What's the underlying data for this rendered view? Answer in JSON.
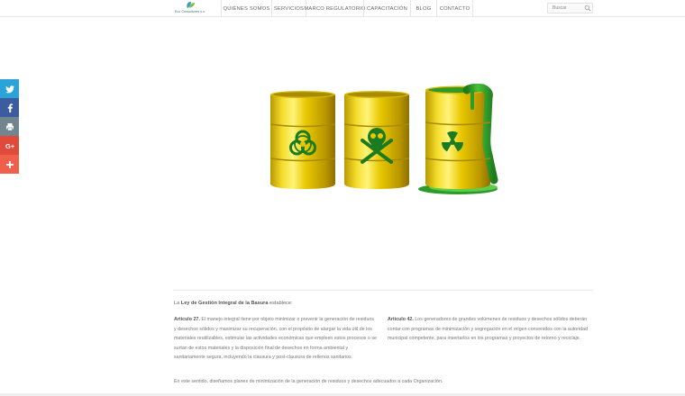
{
  "brand": {
    "logo_text": "Eco Consultores s.c."
  },
  "nav": {
    "items": [
      {
        "label": "QUIÉNES SOMOS",
        "width": 56
      },
      {
        "label": "SERVICIOS",
        "width": 38
      },
      {
        "label": "MARCO REGULATORIO",
        "width": 64
      },
      {
        "label": "CAPACITACIÓN",
        "width": 52
      },
      {
        "label": "BLOG",
        "width": 29
      },
      {
        "label": "CONTACTO",
        "width": 41
      }
    ]
  },
  "search": {
    "placeholder": "Buscar"
  },
  "social": {
    "buttons": [
      {
        "name": "twitter",
        "color": "#2aa3d8"
      },
      {
        "name": "facebook",
        "color": "#3b5d9f"
      },
      {
        "name": "print",
        "color": "#71858e"
      },
      {
        "name": "google-plus",
        "color": "#e04a3a"
      },
      {
        "name": "share-more",
        "color": "#f05f4a"
      }
    ]
  },
  "content": {
    "intro_prefix": "La ",
    "intro_law": "Ley de Gestión Integral de la Basura",
    "intro_suffix": " establece:",
    "art27_title": "Artículo 27.",
    "art27_text": " El manejo integral tiene por objeto minimizar o prevenir la generación de residuos y desechos sólidos y maximizar su recuperación, con el propósito de alargar la vida útil de los materiales reutilizables, estimular las actividades económicas que empleen estos procesos o se surtan de estos materiales y la disposición final de desechos en forma ambiental y sanitariamente segura, incluyendo la clausura y post-clausura de rellenos sanitarios.",
    "art42_title": "Artículo 42.",
    "art42_text": " Los generadores de grandes volúmenes de residuos y desechos sólidos deberán contar con programas de minimización y segregación en el origen convenidos con la autoridad municipal competente, para insertarlos en los programas y proyectos de retorno y reciclaje.",
    "closing": "En este sentido, diseñamos planes de minimización de la generación de residuos y desechos adecuados a cada Organización."
  },
  "colors": {
    "barrel_yellow": "#e8c800",
    "toxic_green": "#2e9a2a"
  }
}
